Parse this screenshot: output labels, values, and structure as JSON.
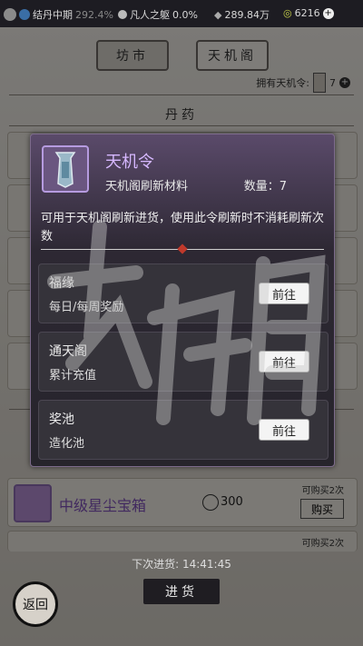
{
  "topbar": {
    "realm": "结丹中期",
    "realm_progress": "292.4%",
    "title": "凡人之躯",
    "title_progress": "0.0%",
    "spirit_stones": "289.84万",
    "currency2": "6216"
  },
  "tabs": [
    {
      "label": "坊市"
    },
    {
      "label": "天机阁"
    }
  ],
  "token_row": {
    "label": "拥有天机令:",
    "count": "7"
  },
  "section": {
    "title": "丹药"
  },
  "modal": {
    "name": "天机令",
    "subtitle": "天机阁刷新材料",
    "quantity": "数量：7",
    "description": "可用于天机阁刷新进货，使用此令刷新时不消耗刷新次数",
    "sources": [
      {
        "title": "福缘",
        "desc": "每日/每周奖励",
        "button": "前往"
      },
      {
        "title": "通天阁",
        "desc": "累计充值",
        "button": "前往"
      },
      {
        "title": "奖池",
        "desc": "造化池",
        "button": "前往"
      }
    ]
  },
  "item": {
    "name": "中级星尘宝箱",
    "price": "300",
    "limit": "可购买2次",
    "buy": "购买"
  },
  "item_next_limit": "可购买2次",
  "next_restock": "下次进货: 14:41:45",
  "restock_button": "进货",
  "back_button": "返回",
  "colors": {
    "accent": "#d6b8ff",
    "modal_bg": "#26242b"
  }
}
